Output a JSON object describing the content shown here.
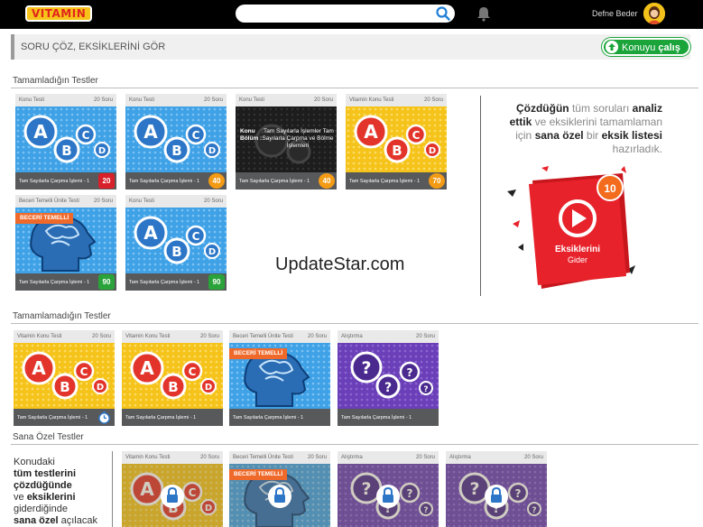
{
  "header": {
    "logo": "VITAMIN",
    "search_placeholder": "",
    "username": "Defne Beder"
  },
  "page": {
    "title": "SORU ÇÖZ, EKSİKLERİNİ GÖR",
    "konu_button_prefix": "Konuyu",
    "konu_button_bold": "çalış"
  },
  "sections": {
    "completed": "Tamamladığın Testler",
    "incomplete": "Tamamlamadığın Testler",
    "special": "Sana Özel Testler"
  },
  "completed_cards": [
    {
      "type": "Konu Testi",
      "count": "20 Soru",
      "name": "Tam Sayılarla Çarpma İşlemi - 1",
      "score": "20",
      "score_color": "red"
    },
    {
      "type": "Konu Testi",
      "count": "20 Soru",
      "name": "Tam Sayılarla Çarpma İşlemi - 1",
      "score": "40",
      "score_color": "orange"
    },
    {
      "type": "Konu Testi",
      "count": "20 Soru",
      "name": "Tam Sayılarla Çarpma İşlemi - 1",
      "score": "40",
      "score_color": "orange",
      "overlay_label1": "Konu",
      "overlay_label2": "Bölüm :",
      "overlay_text": ":Tam Sayılarla İşlemler Tam Sayılarla Çarpma ve Bölme İşlemleri"
    },
    {
      "type": "Vitamin Konu Testi",
      "count": "20 Soru",
      "name": "Tam Sayılarla Çarpma İşlemi - 1",
      "score": "70",
      "score_color": "orange"
    },
    {
      "type": "Beceri Temelli Ünite Testi",
      "count": "20 Soru",
      "name": "Tam Sayılarla Çarpma İşlemi - 1",
      "score": "90",
      "score_color": "green",
      "badge": "BECERİ TEMELLİ"
    },
    {
      "type": "Konu Testi",
      "count": "20 Soru",
      "name": "Tam Sayılarla Çarpma İşlemi - 1",
      "score": "90",
      "score_color": "green"
    }
  ],
  "incomplete_cards": [
    {
      "type": "Vitamin Konu Testi",
      "count": "20 Soru",
      "name": "Tam Sayılarla Çarpma İşlemi - 1"
    },
    {
      "type": "Vitamin Konu Testi",
      "count": "20 Soru",
      "name": "Tam Sayılarla Çarpma İşlemi - 1"
    },
    {
      "type": "Beceri Temelli Ünite Testi",
      "count": "20 Soru",
      "name": "Tam Sayılarla Çarpma İşlemi - 1",
      "badge": "BECERİ TEMELLİ"
    },
    {
      "type": "Alıştırma",
      "count": "20 Soru",
      "name": "Tam Sayılarla Çarpma İşlemi - 1"
    }
  ],
  "special_cards": [
    {
      "type": "Vitamin Konu Testi",
      "count": "20 Soru"
    },
    {
      "type": "Beceri Temelli Ünite Testi",
      "count": "20 Soru",
      "badge": "BECERİ TEMELLİ"
    },
    {
      "type": "Alıştırma",
      "count": "20 Soru"
    },
    {
      "type": "Alıştırma",
      "count": "20 Soru"
    }
  ],
  "promo": {
    "w1": "Çözdüğün",
    "w2": " tüm soruları ",
    "w3": "analiz ettik",
    "w4": " ve eksiklerini tamamlaman için ",
    "w5": "sana özel",
    "w6": " bir ",
    "w7": "eksik listesi",
    "w8": " hazırladık.",
    "count": "10",
    "label1": "Eksiklerini",
    "label2": "Gider"
  },
  "sana_text": {
    "a": "Konudaki ",
    "b": "tüm testlerini çözdüğünde",
    "c": " ve ",
    "d": "eksiklerini",
    "e": " giderdiğinde ",
    "f": "sana özel",
    "g": " açılacak"
  },
  "watermark": "UpdateStar.com",
  "colors": {
    "accent_green": "#1aa43a",
    "score_red": "#d8202a",
    "score_orange": "#f49b16",
    "score_green": "#2aa33a",
    "badge_orange": "#ef6a2a",
    "promo_red": "#e8222b"
  }
}
